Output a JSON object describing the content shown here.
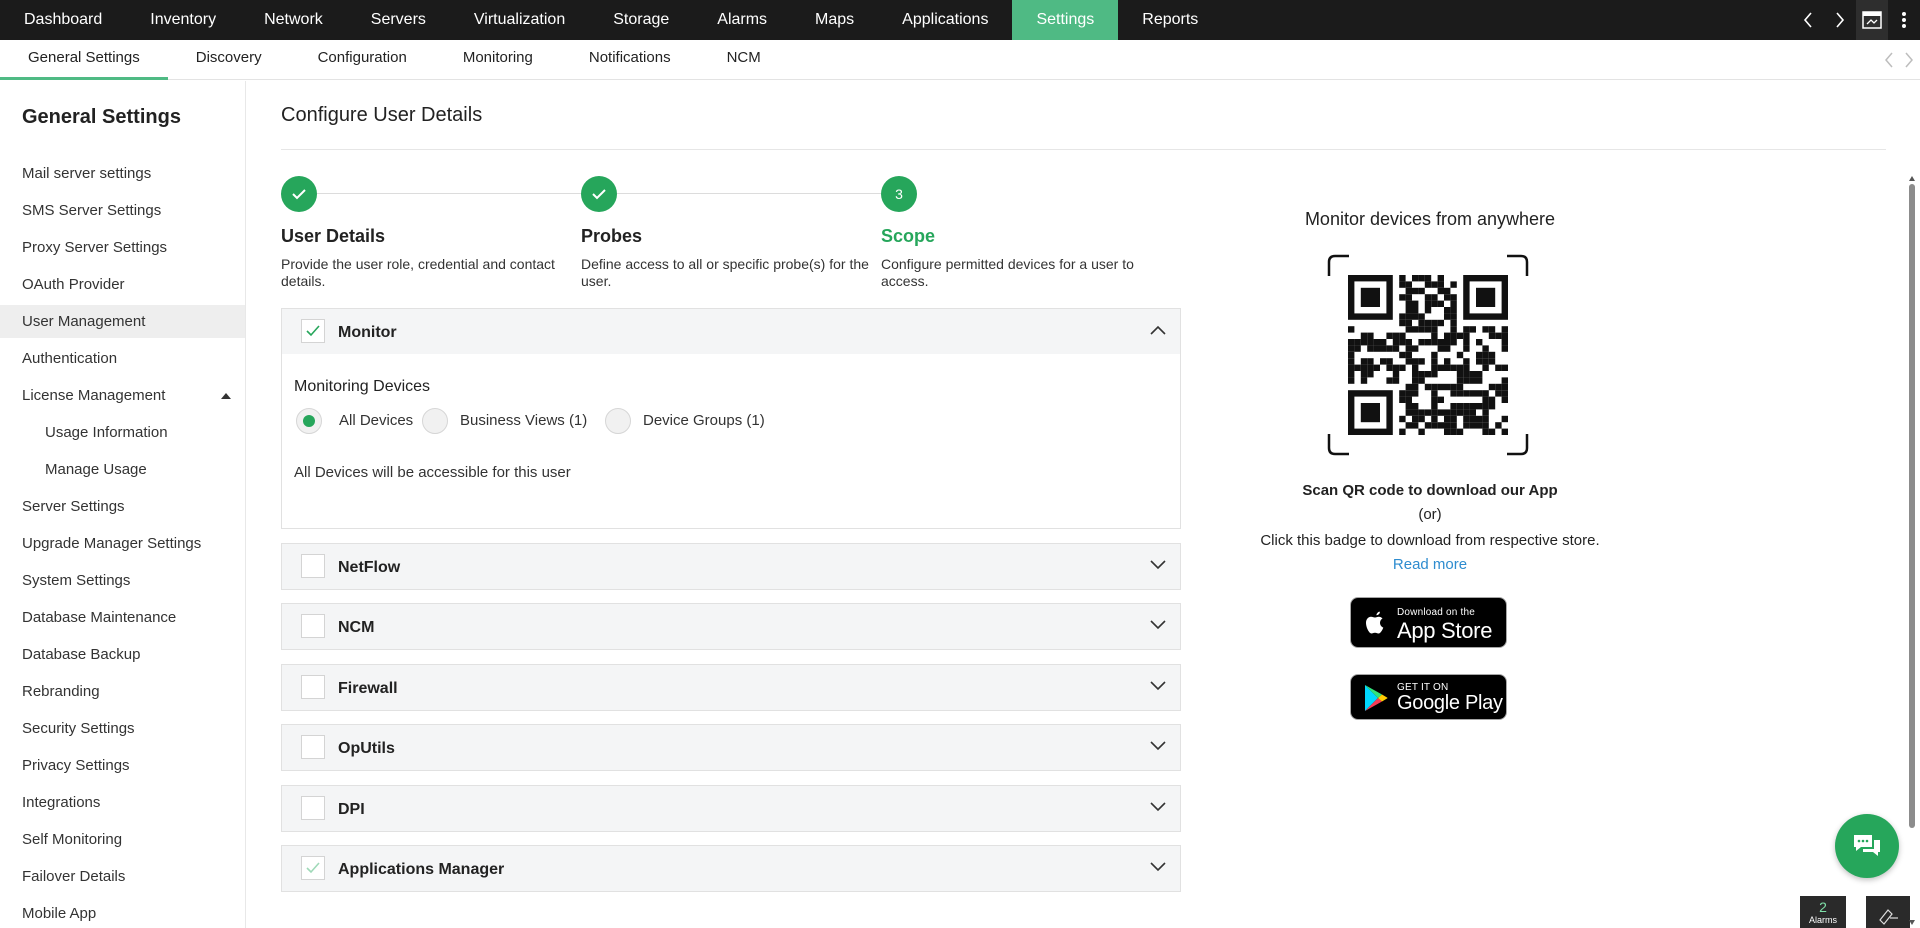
{
  "topnav": {
    "items": [
      "Dashboard",
      "Inventory",
      "Network",
      "Servers",
      "Virtualization",
      "Storage",
      "Alarms",
      "Maps",
      "Applications",
      "Settings",
      "Reports"
    ],
    "active": "Settings"
  },
  "subnav": {
    "items": [
      "General Settings",
      "Discovery",
      "Configuration",
      "Monitoring",
      "Notifications",
      "NCM"
    ],
    "active": "General Settings"
  },
  "sidebar": {
    "title": "General Settings",
    "items": [
      {
        "label": "Mail server settings"
      },
      {
        "label": "SMS Server Settings"
      },
      {
        "label": "Proxy Server Settings"
      },
      {
        "label": "OAuth Provider"
      },
      {
        "label": "User Management"
      },
      {
        "label": "Authentication"
      },
      {
        "label": "License Management"
      },
      {
        "label": "Usage Information"
      },
      {
        "label": "Manage Usage"
      },
      {
        "label": "Server Settings"
      },
      {
        "label": "Upgrade Manager Settings"
      },
      {
        "label": "System Settings"
      },
      {
        "label": "Database Maintenance"
      },
      {
        "label": "Database Backup"
      },
      {
        "label": "Rebranding"
      },
      {
        "label": "Security Settings"
      },
      {
        "label": "Privacy Settings"
      },
      {
        "label": "Integrations"
      },
      {
        "label": "Self Monitoring"
      },
      {
        "label": "Failover Details"
      },
      {
        "label": "Mobile App"
      }
    ],
    "active": "User Management"
  },
  "main": {
    "title": "Configure User Details",
    "steps": [
      {
        "number": "1",
        "title": "User Details",
        "description": "Provide the user role, credential and contact details.",
        "status": "done"
      },
      {
        "number": "2",
        "title": "Probes",
        "description": "Define access to all or specific probe(s) for the user.",
        "status": "done"
      },
      {
        "number": "3",
        "title": "Scope",
        "description": "Configure permitted devices for a user to access.",
        "status": "current"
      }
    ],
    "accordions": [
      {
        "label": "Monitor",
        "checked": true,
        "expanded": true
      },
      {
        "label": "NetFlow",
        "checked": false,
        "expanded": false
      },
      {
        "label": "NCM",
        "checked": false,
        "expanded": false
      },
      {
        "label": "Firewall",
        "checked": false,
        "expanded": false
      },
      {
        "label": "OpUtils",
        "checked": false,
        "expanded": false
      },
      {
        "label": "DPI",
        "checked": false,
        "expanded": false
      },
      {
        "label": "Applications Manager",
        "checked": true,
        "expanded": false
      }
    ],
    "monitor_section": {
      "title": "Monitoring Devices",
      "options": [
        "All Devices",
        "Business Views (1)",
        "Device Groups (1)"
      ],
      "selected": "All Devices",
      "note": "All Devices will be accessible for this user"
    }
  },
  "app_panel": {
    "heading": "Monitor devices from anywhere",
    "scan_text": "Scan QR code to download our App",
    "or_text": "(or)",
    "badge_text": "Click this badge to download from respective store.",
    "read_more": "Read more",
    "app_store": {
      "small": "Download on the",
      "big": "App Store",
      "icon": "apple-icon"
    },
    "google_play": {
      "small": "GET IT ON",
      "big": "Google Play",
      "icon": "play-store-icon"
    }
  },
  "widgets": {
    "alarm_count": "2",
    "alarm_label": "Alarms"
  },
  "colors": {
    "accent": "#26a65b",
    "topnav_active": "#4fba84",
    "topnav_bg": "#1b1b1b",
    "link": "#2e8ccf"
  }
}
